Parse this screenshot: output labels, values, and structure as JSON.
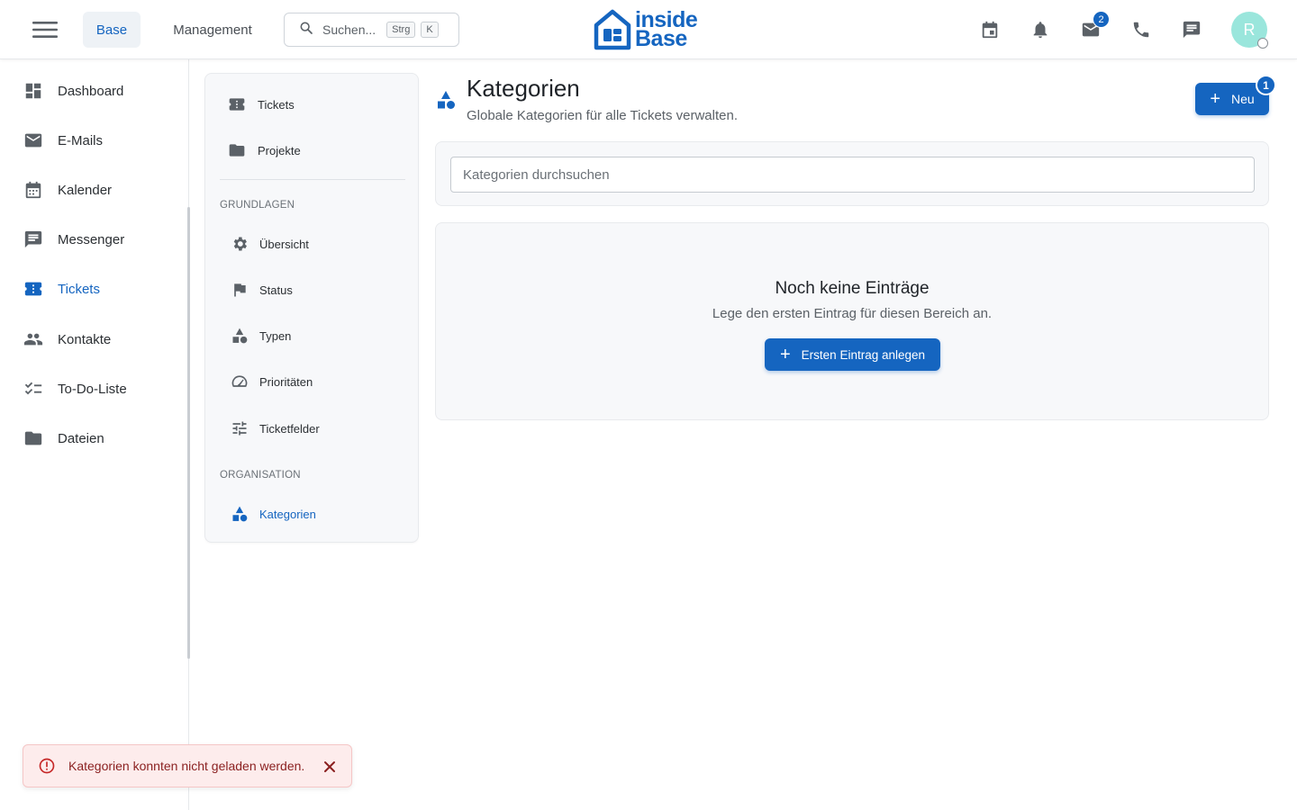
{
  "colors": {
    "accent": "#1565c0",
    "error": "#c62828",
    "avatar_bg": "#9ae6dc"
  },
  "topbar": {
    "menu_icon": "hamburger-icon",
    "tabs": [
      {
        "label": "Base",
        "active": true
      },
      {
        "label": "Management",
        "active": false
      }
    ],
    "search": {
      "placeholder": "Suchen...",
      "shortcut_keys": [
        "Strg",
        "K"
      ]
    },
    "logo": {
      "line1": "inside",
      "line2": "Base"
    },
    "icons": [
      "calendar-icon",
      "bell-icon",
      "mail-icon",
      "phone-icon",
      "chat-icon"
    ],
    "mail_badge": "2",
    "avatar_initial": "R"
  },
  "sidebar": {
    "items": [
      {
        "label": "Dashboard",
        "icon": "dashboard-icon",
        "active": false
      },
      {
        "label": "E-Mails",
        "icon": "mail-icon",
        "active": false
      },
      {
        "label": "Kalender",
        "icon": "calendar-icon",
        "active": false
      },
      {
        "label": "Messenger",
        "icon": "chat-icon",
        "active": false
      },
      {
        "label": "Tickets",
        "icon": "ticket-icon",
        "active": true
      },
      {
        "label": "Kontakte",
        "icon": "people-icon",
        "active": false
      },
      {
        "label": "To-Do-Liste",
        "icon": "checklist-icon",
        "active": false
      },
      {
        "label": "Dateien",
        "icon": "folder-icon",
        "active": false
      }
    ]
  },
  "subnav": {
    "top_items": [
      {
        "label": "Tickets",
        "icon": "ticket-icon"
      },
      {
        "label": "Projekte",
        "icon": "folder-icon"
      }
    ],
    "sections": [
      {
        "heading": "GRUNDLAGEN",
        "items": [
          {
            "label": "Übersicht",
            "icon": "gear-icon"
          },
          {
            "label": "Status",
            "icon": "flag-icon"
          },
          {
            "label": "Typen",
            "icon": "shapes-icon"
          },
          {
            "label": "Prioritäten",
            "icon": "speedometer-icon"
          },
          {
            "label": "Ticketfelder",
            "icon": "sliders-icon"
          }
        ]
      },
      {
        "heading": "ORGANISATION",
        "items": [
          {
            "label": "Kategorien",
            "icon": "shapes-icon",
            "active": true
          }
        ]
      }
    ]
  },
  "main": {
    "title": "Kategorien",
    "subtitle": "Globale Kategorien für alle Tickets verwalten.",
    "new_button": "Neu",
    "new_badge": "1",
    "search_placeholder": "Kategorien durchsuchen",
    "empty": {
      "title": "Noch keine Einträge",
      "subtitle": "Lege den ersten Eintrag für diesen Bereich an.",
      "button": "Ersten Eintrag anlegen"
    }
  },
  "toast": {
    "message": "Kategorien konnten nicht geladen werden."
  }
}
